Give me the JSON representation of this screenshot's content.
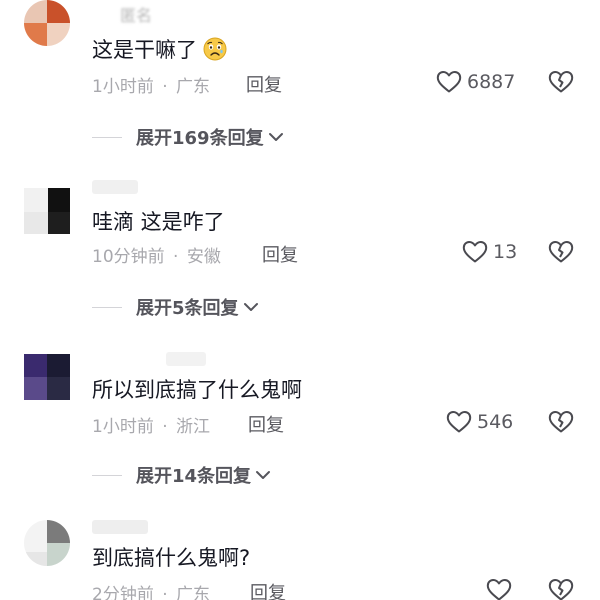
{
  "comments": [
    {
      "username": "匿名",
      "text": "这是干嘛了",
      "emoji": "anguished-face-emoji",
      "time": "1小时前",
      "separator": "·",
      "location": "广东",
      "reply_label": "回复",
      "likes": "6887",
      "expand_label": "展开169条回复",
      "avatar_colors": [
        "#e9c6b3",
        "#c9512a",
        "#e07a4a",
        "#f0d2c0"
      ]
    },
    {
      "username": "",
      "text": "哇滴 这是咋了",
      "time": "10分钟前",
      "separator": "·",
      "location": "安徽",
      "reply_label": "回复",
      "likes": "13",
      "expand_label": "展开5条回复",
      "avatar_colors": [
        "#f1f1f1",
        "#111111",
        "#e8e8e8",
        "#1e1e1e"
      ]
    },
    {
      "username": "",
      "text": "所以到底搞了什么鬼啊",
      "time": "1小时前",
      "separator": "·",
      "location": "浙江",
      "reply_label": "回复",
      "likes": "546",
      "expand_label": "展开14条回复",
      "avatar_colors": [
        "#3a2a6e",
        "#1b1b33",
        "#5a4a8a",
        "#2a2a44"
      ]
    },
    {
      "username": "",
      "text": "到底搞什么鬼啊?",
      "time": "2分钟前",
      "separator": "·",
      "location": "广东",
      "reply_label": "回复",
      "likes": "",
      "avatar_colors": [
        "#f3f3f3",
        "#7b7b7b",
        "#c8d4cc",
        "#e6e6e6"
      ]
    }
  ]
}
